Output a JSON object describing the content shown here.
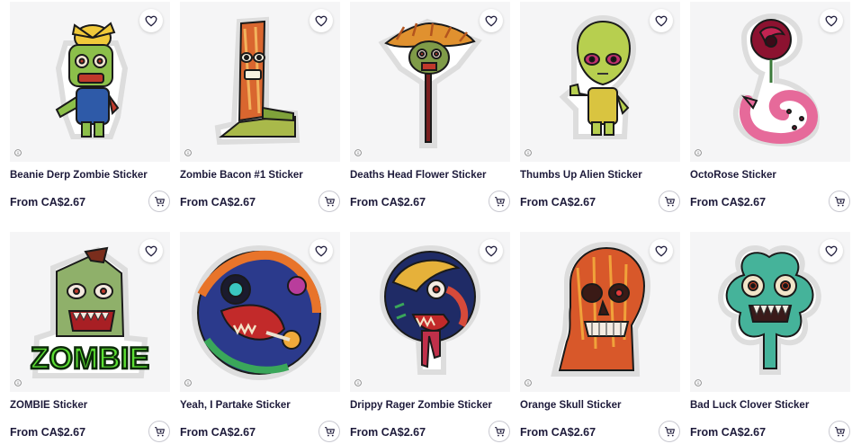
{
  "products": [
    {
      "title": "Beanie Derp Zombie Sticker",
      "price": "From CA$2.67",
      "art": "beanie-zombie"
    },
    {
      "title": "Zombie Bacon #1 Sticker",
      "price": "From CA$2.67",
      "art": "zombie-bacon"
    },
    {
      "title": "Deaths Head Flower Sticker",
      "price": "From CA$2.67",
      "art": "deaths-head-flower"
    },
    {
      "title": "Thumbs Up Alien Sticker",
      "price": "From CA$2.67",
      "art": "thumbs-up-alien"
    },
    {
      "title": "OctoRose Sticker",
      "price": "From CA$2.67",
      "art": "octorose"
    },
    {
      "title": "ZOMBIE Sticker",
      "price": "From CA$2.67",
      "art": "zombie-text"
    },
    {
      "title": "Yeah, I Partake Sticker",
      "price": "From CA$2.67",
      "art": "partake-skull"
    },
    {
      "title": "Drippy Rager Zombie Sticker",
      "price": "From CA$2.67",
      "art": "drippy-rager"
    },
    {
      "title": "Orange Skull Sticker",
      "price": "From CA$2.67",
      "art": "orange-skull"
    },
    {
      "title": "Bad Luck Clover Sticker",
      "price": "From CA$2.67",
      "art": "bad-luck-clover"
    }
  ],
  "art_labels": {
    "zombie_word": "ZOMBIE"
  },
  "icons": {
    "favorite": "heart-icon",
    "cart": "add-to-cart-icon",
    "info": "info-icon"
  },
  "colors": {
    "text": "#1d1a3a",
    "thumb_bg": "#f5f5f6",
    "zombie_green": "#5ce033"
  }
}
